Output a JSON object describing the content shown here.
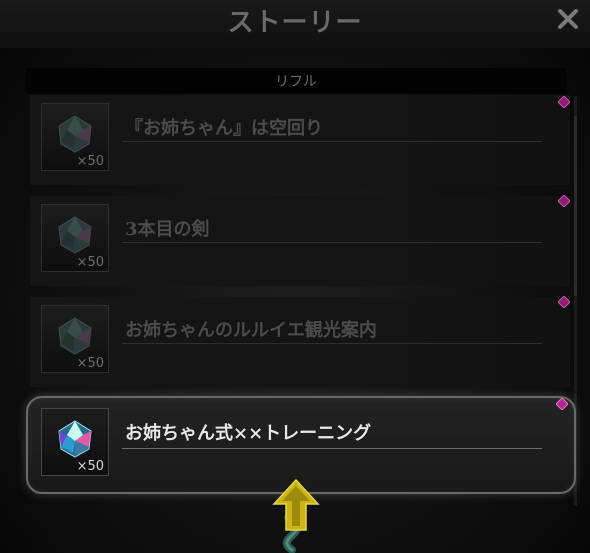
{
  "header": {
    "title": "ストーリー",
    "close_icon": "close-x-icon"
  },
  "subheader": {
    "label": "リフル"
  },
  "stories": [
    {
      "title": "『お姉ちゃん』は空回り",
      "reward_count": "×50",
      "reward_icon": "crystal-gem-icon",
      "state": "inactive"
    },
    {
      "title": "3本目の剣",
      "reward_count": "×50",
      "reward_icon": "crystal-gem-icon",
      "state": "inactive"
    },
    {
      "title": "お姉ちゃんのルルイエ観光案内",
      "reward_count": "×50",
      "reward_icon": "crystal-gem-icon",
      "state": "inactive"
    },
    {
      "title": "お姉ちゃん式××トレーニング",
      "reward_count": "×50",
      "reward_icon": "crystal-gem-icon",
      "state": "selected"
    }
  ],
  "indicators": {
    "new_badge_icon": "purple-diamond-icon",
    "new_badge_color": "#b0288f"
  },
  "footer": {
    "scroll_icon": "yellow-up-arrow-icon",
    "arrow_color": "#c9b516"
  },
  "colors": {
    "background": "#0d0d0d",
    "row_bg": "#161616",
    "text_dim": "#4b4b4b",
    "text_active": "#e8e8e8"
  }
}
